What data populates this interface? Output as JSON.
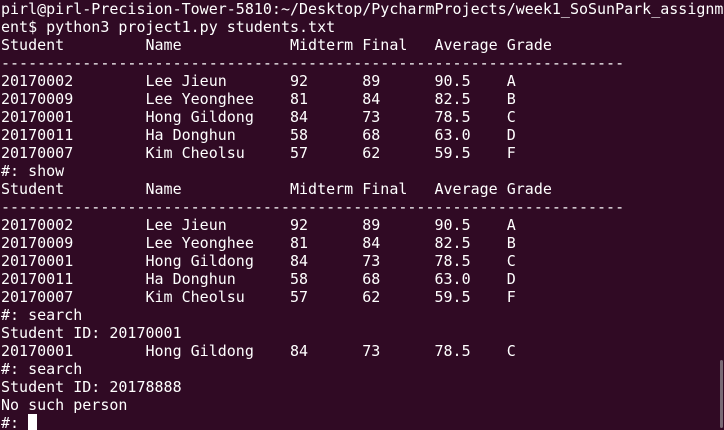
{
  "terminal": {
    "lines": [
      "pirl@pirl-Precision-Tower-5810:~/Desktop/PycharmProjects/week1_SoSunPark_assignm",
      "ent$ python3 project1.py students.txt",
      "Student         Name            Midterm Final   Average Grade",
      "---------------------------------------------------------------------",
      "20170002        Lee Jieun       92      89      90.5    A",
      "20170009        Lee Yeonghee    81      84      82.5    B",
      "20170001        Hong Gildong    84      73      78.5    C",
      "20170011        Ha Donghun      58      68      63.0    D",
      "20170007        Kim Cheolsu     57      62      59.5    F",
      "#: show",
      "Student         Name            Midterm Final   Average Grade",
      "---------------------------------------------------------------------",
      "20170002        Lee Jieun       92      89      90.5    A",
      "20170009        Lee Yeonghee    81      84      82.5    B",
      "20170001        Hong Gildong    84      73      78.5    C",
      "20170011        Ha Donghun      58      68      63.0    D",
      "20170007        Kim Cheolsu     57      62      59.5    F",
      "#: search",
      "Student ID: 20170001",
      "20170001        Hong Gildong    84      73      78.5    C",
      "#: search",
      "Student ID: 20178888",
      "No such person"
    ],
    "prompt": "#: ",
    "colors": {
      "background": "#300a24",
      "foreground": "#ffffff"
    }
  }
}
